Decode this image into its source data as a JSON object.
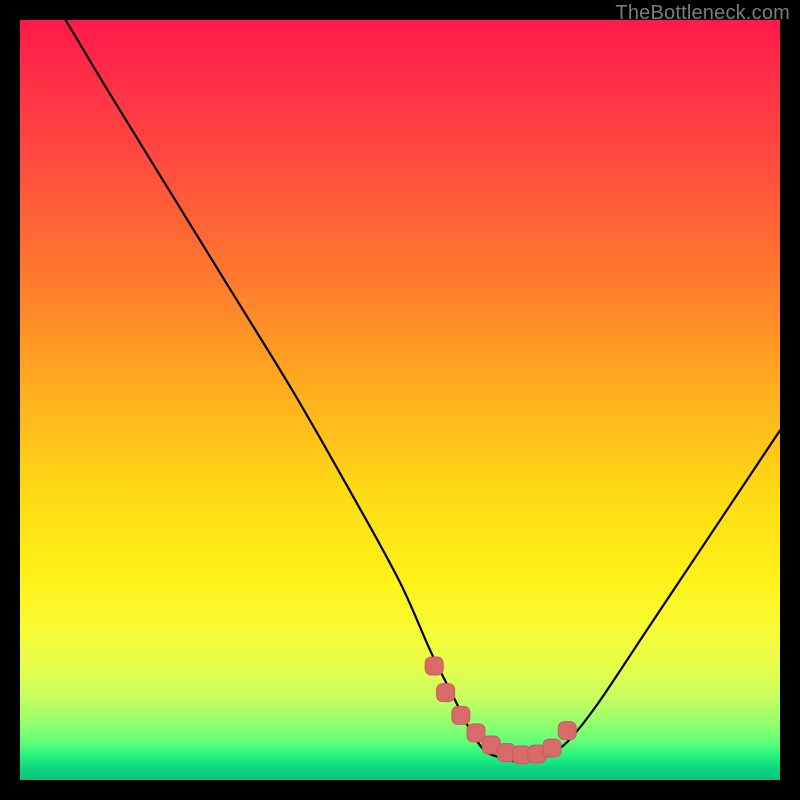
{
  "watermark": "TheBottleneck.com",
  "colors": {
    "background": "#000000",
    "curve_stroke": "#000000",
    "marker_fill": "#d96a6a",
    "marker_stroke": "#c75c5c"
  },
  "chart_data": {
    "type": "line",
    "title": "",
    "xlabel": "",
    "ylabel": "",
    "xlim": [
      0,
      100
    ],
    "ylim": [
      0,
      100
    ],
    "grid": false,
    "legend": false,
    "annotations": [],
    "series": [
      {
        "name": "bottleneck-curve",
        "x": [
          6,
          12,
          20,
          28,
          36,
          44,
          50,
          54,
          57,
          59,
          61,
          63,
          65,
          67,
          69,
          72,
          76,
          82,
          88,
          94,
          100
        ],
        "y": [
          100,
          90,
          77,
          64,
          51,
          37,
          26,
          17,
          11,
          7,
          4,
          3,
          2.5,
          2.5,
          3,
          5,
          10,
          19,
          28,
          37,
          46
        ]
      }
    ],
    "markers": {
      "name": "optimal-range",
      "x": [
        54.5,
        56,
        58,
        60,
        62,
        64,
        66,
        68,
        70,
        72
      ],
      "y": [
        15,
        11.5,
        8.5,
        6.2,
        4.6,
        3.6,
        3.3,
        3.4,
        4.2,
        6.5
      ]
    }
  }
}
